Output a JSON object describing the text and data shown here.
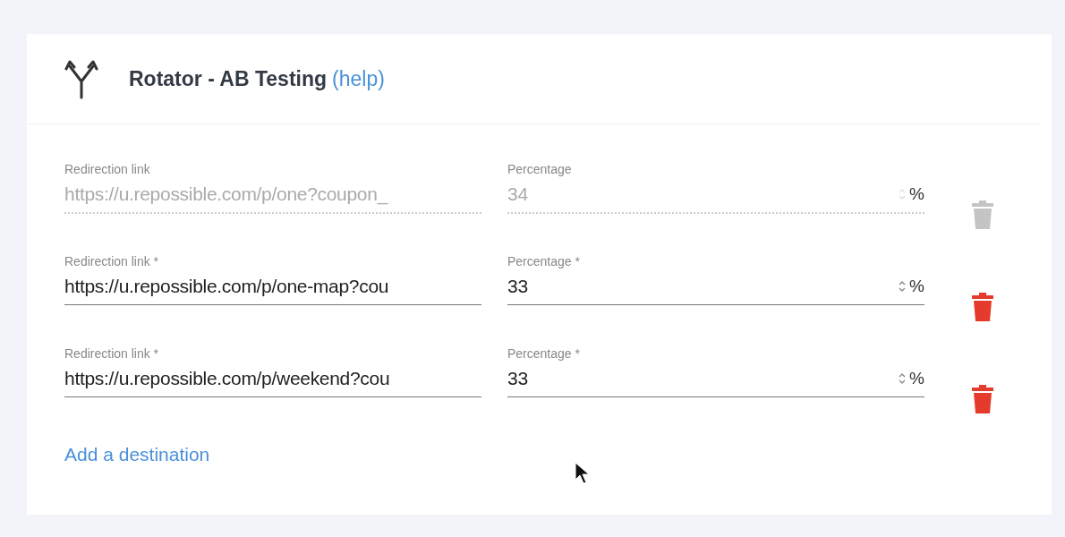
{
  "header": {
    "title": "Rotator - AB Testing",
    "help_link": "(help)"
  },
  "destinations": [
    {
      "disabled": true,
      "link_label": "Redirection link",
      "link": "https://u.repossible.com/p/one?coupon_",
      "percentage_label": "Percentage",
      "percentage": "34",
      "unit": "%"
    },
    {
      "disabled": false,
      "link_label": "Redirection link *",
      "link": "https://u.repossible.com/p/one-map?cou",
      "percentage_label": "Percentage *",
      "percentage": "33",
      "unit": "%"
    },
    {
      "disabled": false,
      "link_label": "Redirection link *",
      "link": "https://u.repossible.com/p/weekend?cou",
      "percentage_label": "Percentage *",
      "percentage": "33",
      "unit": "%"
    }
  ],
  "add_link": "Add a destination"
}
